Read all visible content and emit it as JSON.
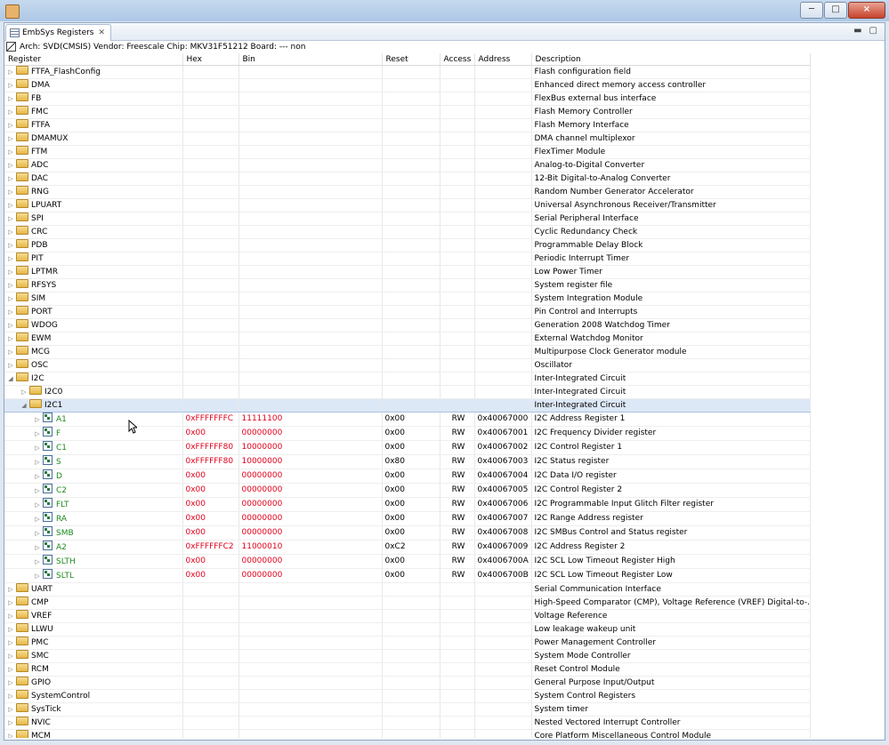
{
  "window": {
    "tab_title": "EmbSys Registers",
    "close_glyph": "×",
    "minimize_glyph": "─",
    "maximize_glyph": "□"
  },
  "info": {
    "text": "Arch: SVD(CMSIS)  Vendor: Freescale  Chip: MKV31F51212  Board: ---   non"
  },
  "columns": {
    "register": "Register",
    "hex": "Hex",
    "bin": "Bin",
    "reset": "Reset",
    "access": "Access",
    "address": "Address",
    "description": "Description"
  },
  "top_peripherals": [
    {
      "name": "FTFA_FlashConfig",
      "description": "Flash configuration field"
    },
    {
      "name": "DMA",
      "description": "Enhanced direct memory access controller"
    },
    {
      "name": "FB",
      "description": "FlexBus external bus interface"
    },
    {
      "name": "FMC",
      "description": "Flash Memory Controller"
    },
    {
      "name": "FTFA",
      "description": "Flash Memory Interface"
    },
    {
      "name": "DMAMUX",
      "description": "DMA channel multiplexor"
    },
    {
      "name": "FTM",
      "description": "FlexTimer Module"
    },
    {
      "name": "ADC",
      "description": "Analog-to-Digital Converter"
    },
    {
      "name": "DAC",
      "description": "12-Bit Digital-to-Analog Converter"
    },
    {
      "name": "RNG",
      "description": "Random Number Generator Accelerator"
    },
    {
      "name": "LPUART",
      "description": "Universal Asynchronous Receiver/Transmitter"
    },
    {
      "name": "SPI",
      "description": "Serial Peripheral Interface"
    },
    {
      "name": "CRC",
      "description": "Cyclic Redundancy Check"
    },
    {
      "name": "PDB",
      "description": "Programmable Delay Block"
    },
    {
      "name": "PIT",
      "description": "Periodic Interrupt Timer"
    },
    {
      "name": "LPTMR",
      "description": "Low Power Timer"
    },
    {
      "name": "RFSYS",
      "description": "System register file"
    },
    {
      "name": "SIM",
      "description": "System Integration Module"
    },
    {
      "name": "PORT",
      "description": "Pin Control and Interrupts"
    },
    {
      "name": "WDOG",
      "description": "Generation 2008 Watchdog Timer"
    },
    {
      "name": "EWM",
      "description": "External Watchdog Monitor"
    },
    {
      "name": "MCG",
      "description": "Multipurpose Clock Generator module"
    },
    {
      "name": "OSC",
      "description": "Oscillator"
    }
  ],
  "i2c": {
    "name": "I2C",
    "description": "Inter-Integrated Circuit"
  },
  "i2c0": {
    "name": "I2C0",
    "description": "Inter-Integrated Circuit"
  },
  "i2c1": {
    "name": "I2C1",
    "description": "Inter-Integrated Circuit"
  },
  "registers": [
    {
      "name": "A1",
      "hex": "0xFFFFFFFC",
      "bin": "11111100",
      "reset": "0x00",
      "access": "RW",
      "address": "0x40067000",
      "description": "I2C Address Register 1"
    },
    {
      "name": "F",
      "hex": "0x00",
      "bin": "00000000",
      "reset": "0x00",
      "access": "RW",
      "address": "0x40067001",
      "description": "I2C Frequency Divider register"
    },
    {
      "name": "C1",
      "hex": "0xFFFFFF80",
      "bin": "10000000",
      "reset": "0x00",
      "access": "RW",
      "address": "0x40067002",
      "description": "I2C Control Register 1"
    },
    {
      "name": "S",
      "hex": "0xFFFFFF80",
      "bin": "10000000",
      "reset": "0x80",
      "access": "RW",
      "address": "0x40067003",
      "description": "I2C Status register"
    },
    {
      "name": "D",
      "hex": "0x00",
      "bin": "00000000",
      "reset": "0x00",
      "access": "RW",
      "address": "0x40067004",
      "description": "I2C Data I/O register"
    },
    {
      "name": "C2",
      "hex": "0x00",
      "bin": "00000000",
      "reset": "0x00",
      "access": "RW",
      "address": "0x40067005",
      "description": "I2C Control Register 2"
    },
    {
      "name": "FLT",
      "hex": "0x00",
      "bin": "00000000",
      "reset": "0x00",
      "access": "RW",
      "address": "0x40067006",
      "description": "I2C Programmable Input Glitch Filter register"
    },
    {
      "name": "RA",
      "hex": "0x00",
      "bin": "00000000",
      "reset": "0x00",
      "access": "RW",
      "address": "0x40067007",
      "description": "I2C Range Address register"
    },
    {
      "name": "SMB",
      "hex": "0x00",
      "bin": "00000000",
      "reset": "0x00",
      "access": "RW",
      "address": "0x40067008",
      "description": "I2C SMBus Control and Status register"
    },
    {
      "name": "A2",
      "hex": "0xFFFFFFC2",
      "bin": "11000010",
      "reset": "0xC2",
      "access": "RW",
      "address": "0x40067009",
      "description": "I2C Address Register 2"
    },
    {
      "name": "SLTH",
      "hex": "0x00",
      "bin": "00000000",
      "reset": "0x00",
      "access": "RW",
      "address": "0x4006700A",
      "description": "I2C SCL Low Timeout Register High"
    },
    {
      "name": "SLTL",
      "hex": "0x00",
      "bin": "00000000",
      "reset": "0x00",
      "access": "RW",
      "address": "0x4006700B",
      "description": "I2C SCL Low Timeout Register Low"
    }
  ],
  "bottom_peripherals": [
    {
      "name": "UART",
      "description": "Serial Communication Interface"
    },
    {
      "name": "CMP",
      "description": "High-Speed Comparator (CMP), Voltage Reference (VREF) Digital-to-..."
    },
    {
      "name": "VREF",
      "description": "Voltage Reference"
    },
    {
      "name": "LLWU",
      "description": "Low leakage wakeup unit"
    },
    {
      "name": "PMC",
      "description": "Power Management Controller"
    },
    {
      "name": "SMC",
      "description": "System Mode Controller"
    },
    {
      "name": "RCM",
      "description": "Reset Control Module"
    },
    {
      "name": "GPIO",
      "description": "General Purpose Input/Output"
    },
    {
      "name": "SystemControl",
      "description": "System Control Registers"
    },
    {
      "name": "SysTick",
      "description": "System timer"
    },
    {
      "name": "NVIC",
      "description": "Nested Vectored Interrupt Controller"
    },
    {
      "name": "MCM",
      "description": "Core Platform Miscellaneous Control Module"
    }
  ],
  "icons": {
    "expand": "▷",
    "collapse": "◢"
  },
  "colors": {
    "name_green": "#1e8b1e",
    "value_red": "#e2001a",
    "selection": "#dde8f6"
  }
}
